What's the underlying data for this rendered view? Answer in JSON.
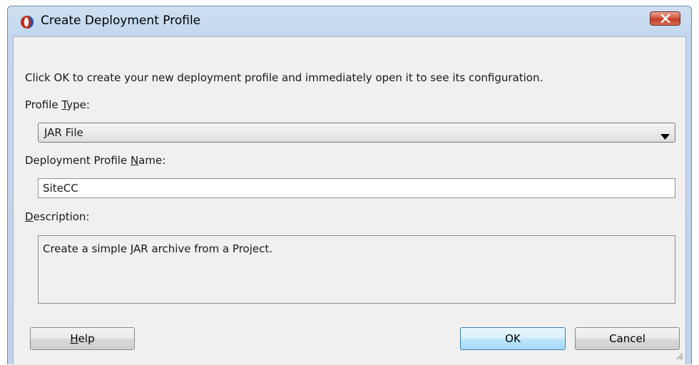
{
  "window": {
    "title": "Create Deployment Profile"
  },
  "dialog": {
    "intro": "Click OK to create your new deployment profile and immediately open it to see its configuration.",
    "profile_type_label_pre": "Profile ",
    "profile_type_label_mnemonic": "T",
    "profile_type_label_post": "ype:",
    "profile_type_value": "JAR File",
    "name_label_pre": "Deployment Profile ",
    "name_label_mnemonic": "N",
    "name_label_post": "ame:",
    "name_value": "SiteCC",
    "description_label_mnemonic": "D",
    "description_label_post": "escription:",
    "description_text": "Create a simple JAR archive from a Project."
  },
  "buttons": {
    "help_mnemonic": "H",
    "help_rest": "elp",
    "ok": "OK",
    "cancel": "Cancel"
  },
  "icons": {
    "app": "oracle-jdeveloper-icon",
    "close": "close-icon",
    "dropdown": "chevron-down-icon",
    "resize": "resize-grip-icon"
  },
  "colors": {
    "titlebar": "#c3d7ee",
    "close_button": "#c23c25",
    "client_bg": "#f0f0f0",
    "default_button": "#bee6fd"
  }
}
